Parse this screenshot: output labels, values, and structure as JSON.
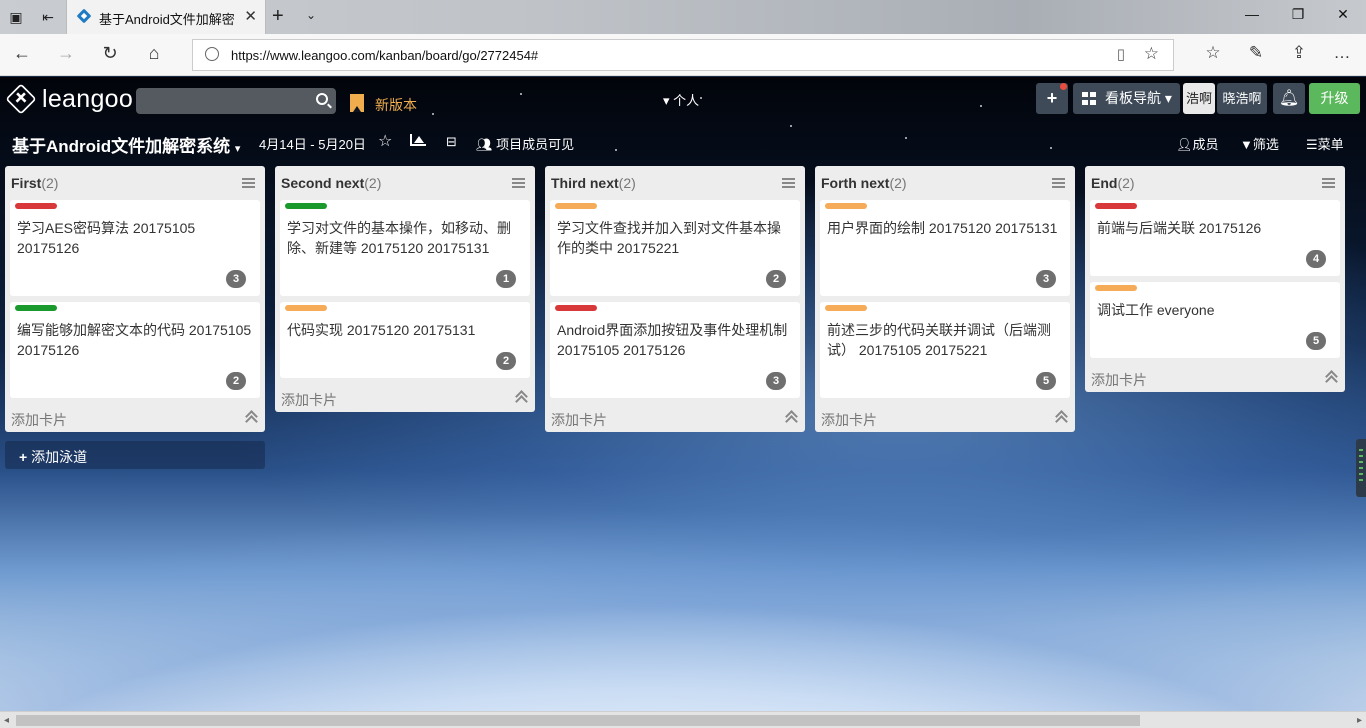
{
  "browser": {
    "tab_title": "基于Android文件加解密",
    "url": "https://www.leangoo.com/kanban/board/go/2772454#",
    "icons": [
      "tab-list-icon",
      "back-tabs-icon",
      "close-icon",
      "new-tab-icon",
      "chevron-down-icon",
      "minimize-icon",
      "restore-icon",
      "close-window-icon",
      "back-icon",
      "forward-icon",
      "refresh-icon",
      "home-icon",
      "globe-icon",
      "reading-view-icon",
      "favorite-star-icon",
      "favorites-icon",
      "notes-icon",
      "share-icon"
    ]
  },
  "header": {
    "brand": "leangoo",
    "new_version": "新版本",
    "personal": "个人",
    "board_nav": "看板导航",
    "user_short": "浩啊",
    "user_name": "晓浩啊",
    "upgrade": "升级",
    "accent_color": "#5cb85c"
  },
  "subbar": {
    "board_title": "基于Android文件加解密系统",
    "date_range": "4月14日 - 5月20日",
    "visibility": "项目成员可见",
    "members": "成员",
    "filter": "筛选",
    "menu": "菜单"
  },
  "lanes": [
    {
      "name": "First",
      "count": "(2)",
      "cards": [
        {
          "tag": "#d9383a",
          "text": "学习AES密码算法  20175105  20175126",
          "badge": "3"
        },
        {
          "tag": "#1a9a2c",
          "text": "编写能够加解密文本的代码  20175105  20175126",
          "badge": "2"
        }
      ]
    },
    {
      "name": "Second next",
      "count": "(2)",
      "cards": [
        {
          "tag": "#1a9a2c",
          "text": "学习对文件的基本操作，如移动、删除、新建等  20175120  20175131",
          "badge": "1"
        },
        {
          "tag": "#f5ab58",
          "text": "代码实现 20175120   20175131",
          "badge": "2"
        }
      ]
    },
    {
      "name": "Third next",
      "count": "(2)",
      "cards": [
        {
          "tag": "#f5ab58",
          "text": "学习文件查找并加入到对文件基本操作的类中  20175221",
          "badge": "2"
        },
        {
          "tag": "#d9383a",
          "text": "Android界面添加按钮及事件处理机制  20175105  20175126",
          "badge": "3"
        }
      ]
    },
    {
      "name": "Forth next",
      "count": "(2)",
      "cards": [
        {
          "tag": "#f5ab58",
          "text": "用户界面的绘制  20175120  20175131",
          "badge": "3"
        },
        {
          "tag": "#f5ab58",
          "text": "前述三步的代码关联并调试（后端测试）  20175105 20175221",
          "badge": "5"
        }
      ]
    },
    {
      "name": "End",
      "count": "(2)",
      "cards": [
        {
          "tag": "#d9383a",
          "text": "前端与后端关联  20175126",
          "badge": "4"
        },
        {
          "tag": "#f5ab58",
          "text": "调试工作  everyone",
          "badge": "5"
        }
      ]
    }
  ],
  "add_card_label": "添加卡片",
  "add_lane_label": "添加泳道"
}
